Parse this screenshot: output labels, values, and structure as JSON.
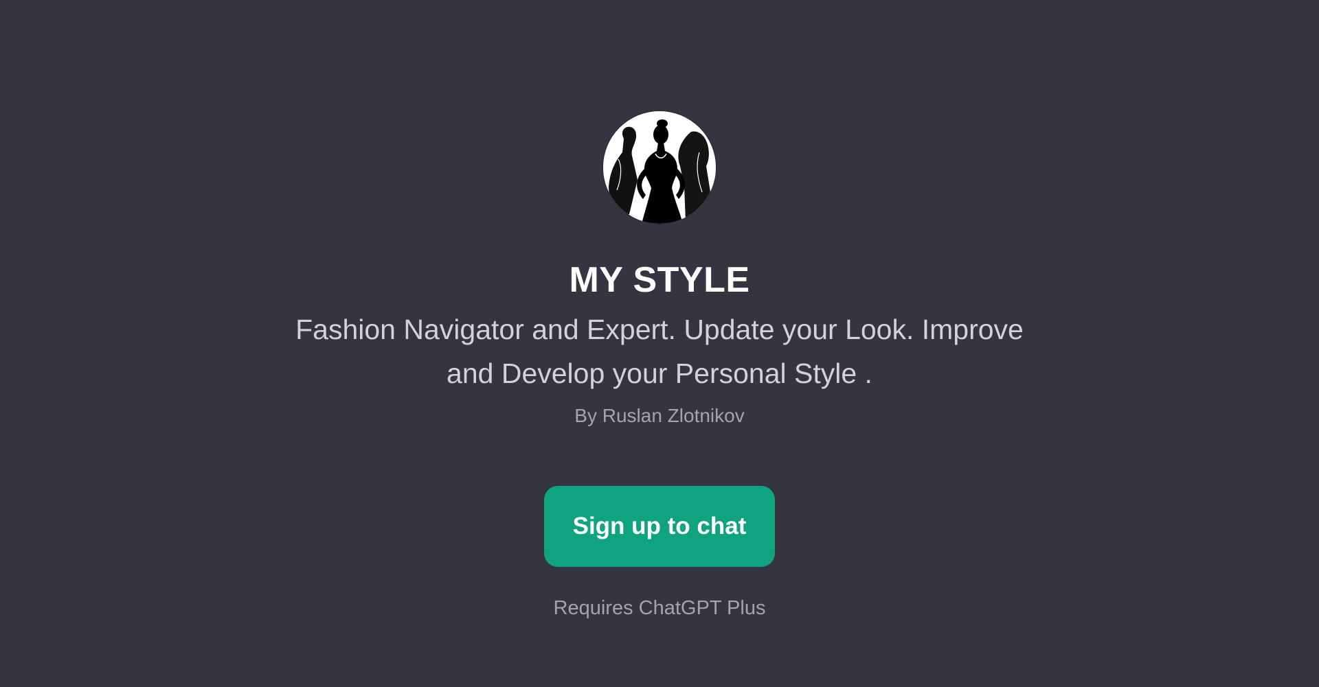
{
  "gpt": {
    "icon": "fashion-silhouettes-avatar",
    "title": "MY STYLE",
    "description": "Fashion Navigator and Expert. Update your Look. Improve and Develop your Personal Style .",
    "author": "By Ruslan Zlotnikov"
  },
  "cta": {
    "label": "Sign up to chat",
    "requirement": "Requires ChatGPT Plus"
  },
  "colors": {
    "background": "#343541",
    "title": "#ffffff",
    "description": "#d1d2db",
    "muted": "#a3a4ad",
    "accent": "#10a37f"
  }
}
